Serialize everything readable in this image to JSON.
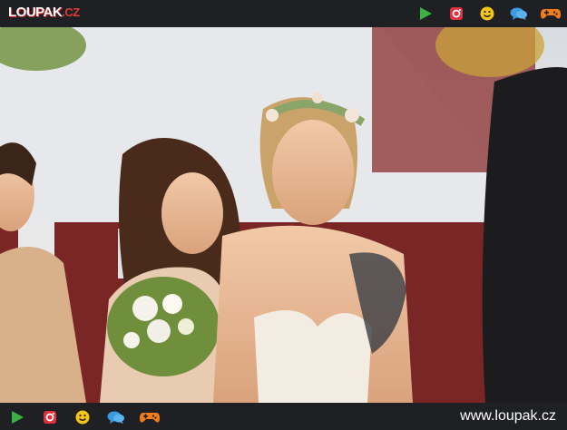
{
  "header": {
    "logo_text": "LOUPAK",
    "logo_domain": ".CZ",
    "icons": [
      "play-icon",
      "instagram-icon",
      "smiley-icon",
      "chat-icon",
      "gamepad-icon"
    ]
  },
  "footer": {
    "url": "www.loupak.cz",
    "icons": [
      "play-icon",
      "instagram-icon",
      "smiley-icon",
      "chat-icon",
      "gamepad-icon"
    ]
  },
  "colors": {
    "bar_bg": "#1f2024",
    "play": "#3cb043",
    "instagram": "#e0303e",
    "smiley": "#f5c518",
    "chat": "#3a9be0",
    "gamepad": "#f07d1a"
  }
}
